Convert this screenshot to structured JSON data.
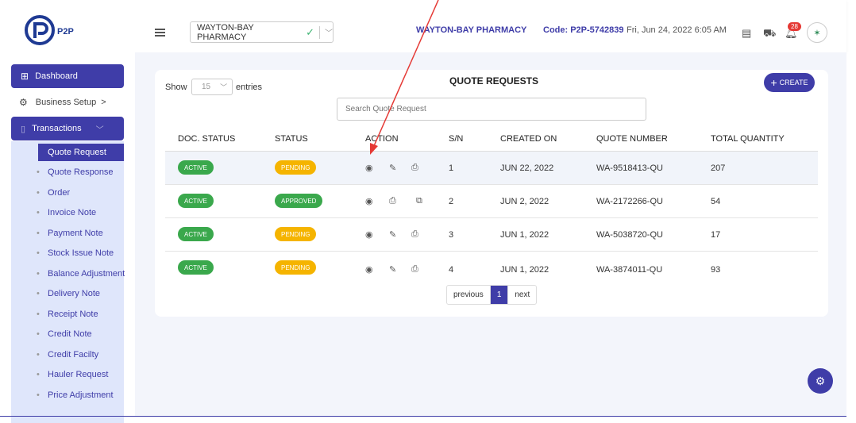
{
  "header": {
    "logo_text": "P2P",
    "store_select": "WAYTON-BAY PHARMACY",
    "store_name": "WAYTON-BAY PHARMACY",
    "code": "Code: P2P-5742839",
    "datetime": "Fri, Jun 24, 2022 6:05 AM",
    "notification_count": "28"
  },
  "sidebar": {
    "dashboard": "Dashboard",
    "business_setup": "Business Setup",
    "business_setup_chevron": ">",
    "transactions": "Transactions",
    "items": [
      "Quote Request",
      "Quote Response",
      "Order",
      "Invoice Note",
      "Payment Note",
      "Stock Issue Note",
      "Balance Adjustment",
      "Delivery Note",
      "Receipt Note",
      "Credit Note",
      "Credit Facilty",
      "Hauler Request",
      "Price Adjustment"
    ]
  },
  "main": {
    "show_label": "Show",
    "entries_value": "15",
    "entries_label": "entries",
    "title": "QUOTE REQUESTS",
    "create_label": "CREATE",
    "search_placeholder": "Search Quote Request",
    "columns": [
      "DOC. STATUS",
      "STATUS",
      "ACTION",
      "S/N",
      "CREATED ON",
      "QUOTE NUMBER",
      "TOTAL QUANTITY"
    ],
    "rows": [
      {
        "doc_status": "ACTIVE",
        "status": "PENDING",
        "sn": "1",
        "created": "JUN 22, 2022",
        "quote": "WA-9518413-QU",
        "qty": "207"
      },
      {
        "doc_status": "ACTIVE",
        "status": "APPROVED",
        "sn": "2",
        "created": "JUN 2, 2022",
        "quote": "WA-2172266-QU",
        "qty": "54"
      },
      {
        "doc_status": "ACTIVE",
        "status": "PENDING",
        "sn": "3",
        "created": "JUN 1, 2022",
        "quote": "WA-5038720-QU",
        "qty": "17"
      },
      {
        "doc_status": "ACTIVE",
        "status": "PENDING",
        "sn": "4",
        "created": "JUN 1, 2022",
        "quote": "WA-3874011-QU",
        "qty": "93"
      }
    ],
    "pager": {
      "previous": "previous",
      "current": "1",
      "next": "next"
    }
  },
  "colors": {
    "primary": "#3f3da8",
    "active": "#3aa84c",
    "pending": "#f5b400",
    "annotation_arrow": "#e53935"
  }
}
